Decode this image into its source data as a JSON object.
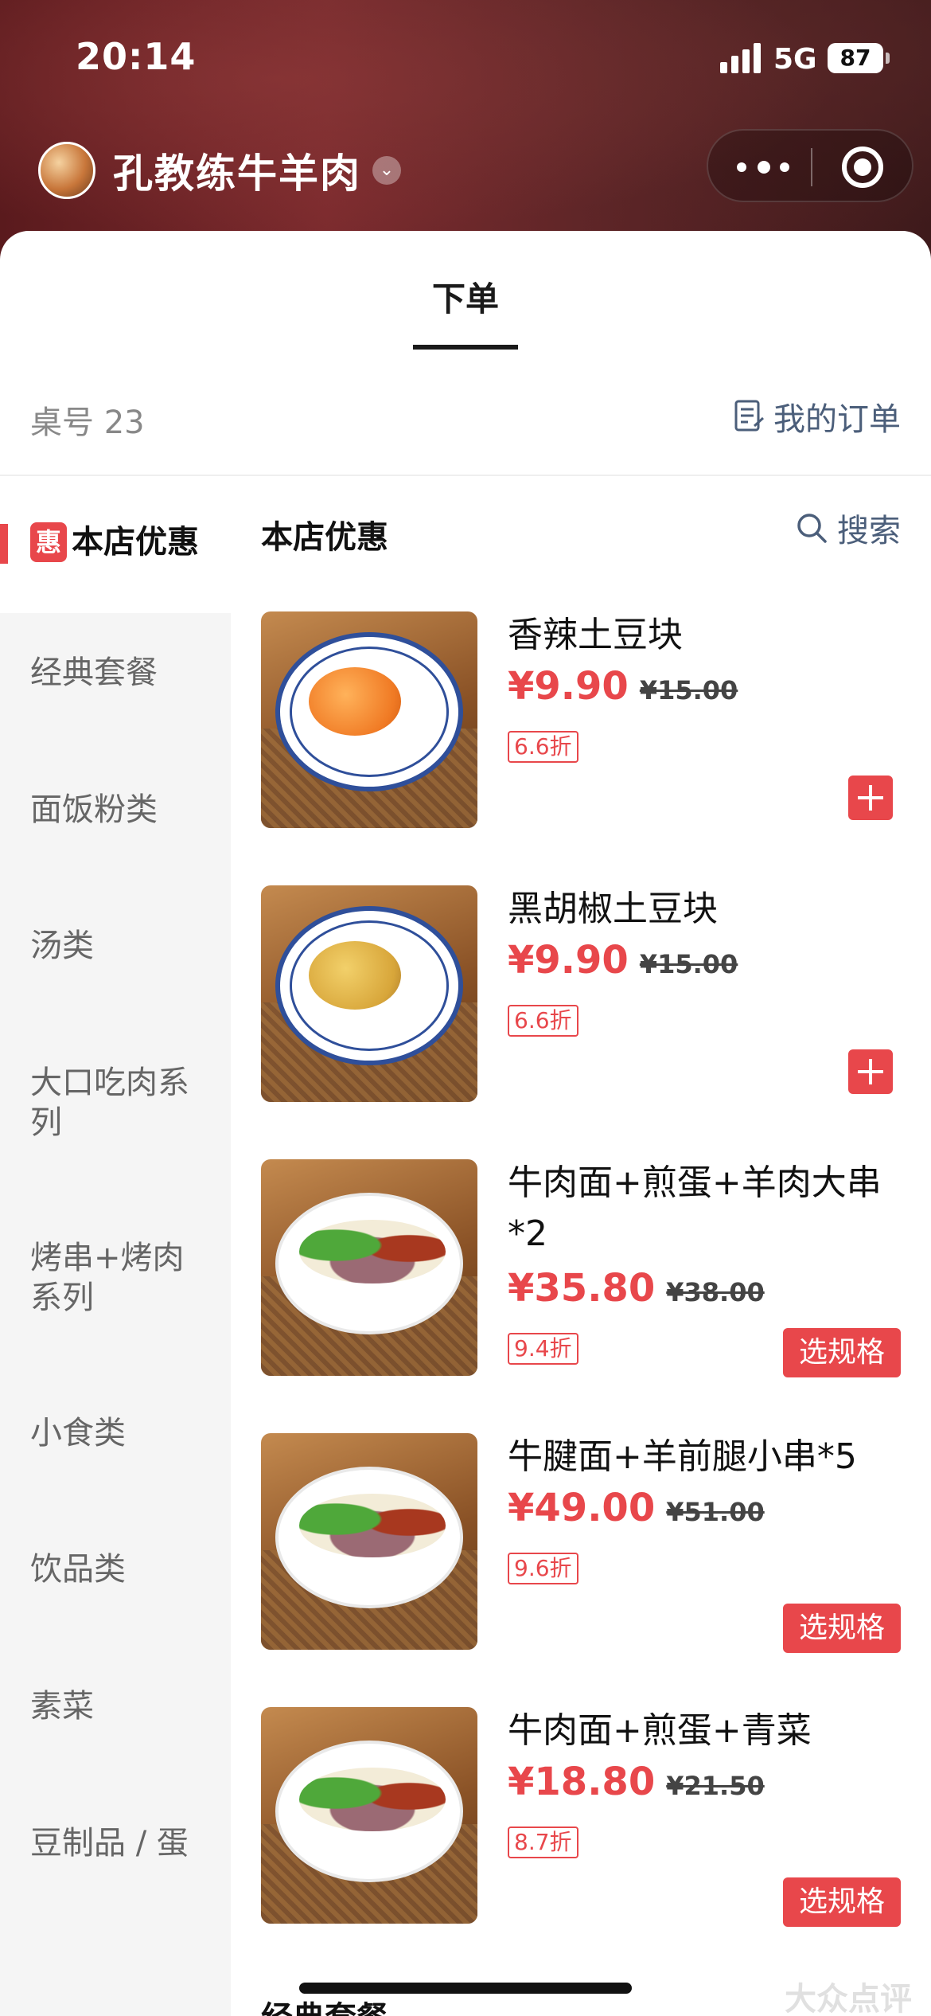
{
  "status_bar": {
    "time": "20:14",
    "network": "5G",
    "battery": "87"
  },
  "header": {
    "shop_name": "孔教练牛羊肉",
    "caret": "⌄"
  },
  "tabs": {
    "order": "下单"
  },
  "info": {
    "table_no": "桌号 23",
    "my_orders": "我的订单"
  },
  "sidebar": {
    "active_badge": "惠",
    "active_label": "本店优惠",
    "items": [
      "经典套餐",
      "面饭粉类",
      "汤类",
      "大口吃肉系列",
      "烤串+烤肉系列",
      "小食类",
      "饮品类",
      "素菜",
      "豆制品 / 蛋"
    ]
  },
  "content": {
    "section_title": "本店优惠",
    "search_label": "搜索",
    "next_section": "经典套餐",
    "items": [
      {
        "name": "香辣土豆块",
        "price": "¥9.90",
        "original_price": "¥15.00",
        "discount": "6.6折",
        "action": "add"
      },
      {
        "name": "黑胡椒土豆块",
        "price": "¥9.90",
        "original_price": "¥15.00",
        "discount": "6.6折",
        "action": "add"
      },
      {
        "name": "牛肉面+煎蛋+羊肉大串*2",
        "price": "¥35.80",
        "original_price": "¥38.00",
        "discount": "9.4折",
        "action": "选规格"
      },
      {
        "name": "牛腱面+羊前腿小串*5",
        "price": "¥49.00",
        "original_price": "¥51.00",
        "discount": "9.6折",
        "action": "选规格"
      },
      {
        "name": "牛肉面+煎蛋+青菜",
        "price": "¥18.80",
        "original_price": "¥21.50",
        "discount": "8.7折",
        "action": "选规格"
      }
    ]
  },
  "watermark": "大众点评",
  "colors": {
    "accent": "#e8474b",
    "link": "#4b5e7a"
  }
}
